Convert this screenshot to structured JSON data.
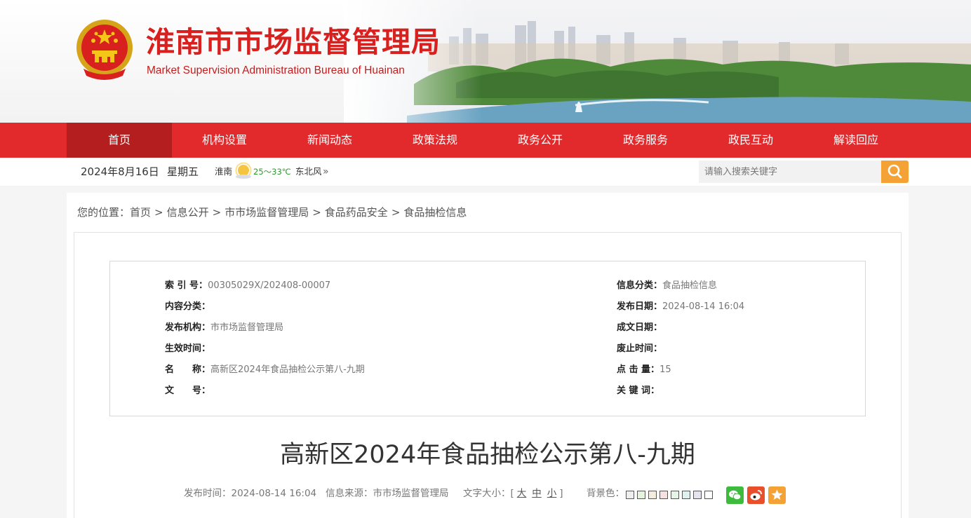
{
  "header": {
    "title": "淮南市市场监督管理局",
    "subtitle": "Market Supervision Administration Bureau of Huainan"
  },
  "nav": {
    "items": [
      {
        "label": "首页"
      },
      {
        "label": "机构设置"
      },
      {
        "label": "新闻动态"
      },
      {
        "label": "政策法规"
      },
      {
        "label": "政务公开"
      },
      {
        "label": "政务服务"
      },
      {
        "label": "政民互动"
      },
      {
        "label": "解读回应"
      }
    ]
  },
  "toolbar": {
    "date": "2024年8月16日",
    "weekday": "星期五",
    "weather": {
      "city": "淮南",
      "icon": "sun-icon",
      "temp": "25～33℃",
      "wind": "东北风"
    },
    "search_placeholder": "请输入搜索关键字"
  },
  "breadcrumb": {
    "prefix": "您的位置：",
    "items": [
      "首页",
      "信息公开",
      "市市场监督管理局",
      "食品药品安全",
      "食品抽检信息"
    ],
    "separator": ">"
  },
  "info": {
    "index_no": {
      "key": "索 引 号：",
      "value": "00305029X/202408-00007"
    },
    "category": {
      "key": "信息分类：",
      "value": "食品抽检信息"
    },
    "content_class": {
      "key": "内容分类：",
      "value": ""
    },
    "publish_date": {
      "key": "发布日期：",
      "value": "2024-08-14 16:04"
    },
    "publisher": {
      "key": "发布机构：",
      "value": "市市场监督管理局"
    },
    "written_date": {
      "key": "成文日期：",
      "value": ""
    },
    "effective_date": {
      "key": "生效时间：",
      "value": ""
    },
    "expire_date": {
      "key": "废止时间：",
      "value": ""
    },
    "name": {
      "key": "名　　称：",
      "value": "高新区2024年食品抽检公示第八-九期"
    },
    "clicks": {
      "key": "点 击 量：",
      "value": "15"
    },
    "doc_no": {
      "key": "文　　号：",
      "value": ""
    },
    "keywords": {
      "key": "关 键 词：",
      "value": ""
    }
  },
  "article": {
    "title": "高新区2024年食品抽检公示第八-九期",
    "publish_time": "发布时间：2024-08-14 16:04",
    "source": "信息来源：市市场监督管理局",
    "font_size_label": "文字大小：[",
    "font_sizes": [
      "大",
      "中",
      "小"
    ],
    "font_size_close": "]",
    "bg_label": "背景色：",
    "bg_colors": [
      "#eeeeee",
      "#e5f2dc",
      "#f5ece0",
      "#f8e0e0",
      "#e6f4e6",
      "#dff0f0",
      "#e4e4f0",
      "#ffffff"
    ],
    "share": [
      {
        "icon": "wechat-icon",
        "color": "#3dbb3d"
      },
      {
        "icon": "weibo-icon",
        "color": "#e84f2a"
      },
      {
        "icon": "favorite-star-icon",
        "color": "#f4a236"
      }
    ]
  },
  "colors": {
    "brand_red": "#e2292c",
    "nav_active": "#b51e1f",
    "search_accent": "#f4a236"
  }
}
